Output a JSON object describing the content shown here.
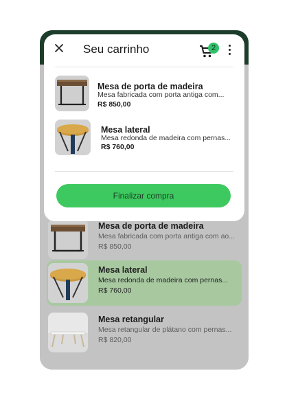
{
  "header": {
    "title": "Seu carrinho",
    "cart_count": "2"
  },
  "cart_items": [
    {
      "name": "Mesa de porta de madeira",
      "description": "Mesa fabricada com porta antiga com...",
      "price": "R$ 850,00"
    },
    {
      "name": "Mesa lateral",
      "description": "Mesa redonda de madeira com pernas...",
      "price": "R$ 760,00"
    }
  ],
  "checkout_label": "Finalizar compra",
  "catalog": [
    {
      "name": "Mesa de porta de madeira",
      "description": "Mesa fabricada com porta antiga com ao...",
      "price": "R$ 850,00",
      "selected": false
    },
    {
      "name": "Mesa lateral",
      "description": "Mesa redonda de madeira com pernas...",
      "price": "R$ 760,00",
      "selected": true
    },
    {
      "name": "Mesa retangular",
      "description": "Mesa retangular de plátano com pernas...",
      "price": "R$ 820,00",
      "selected": false
    }
  ],
  "colors": {
    "accent": "#3dc95f",
    "badge": "#2ec26a",
    "selected_row": "#a8c9a0",
    "header_bar": "#1d3d2b"
  },
  "icons": [
    "close-icon",
    "cart-icon",
    "more-vert-icon"
  ]
}
